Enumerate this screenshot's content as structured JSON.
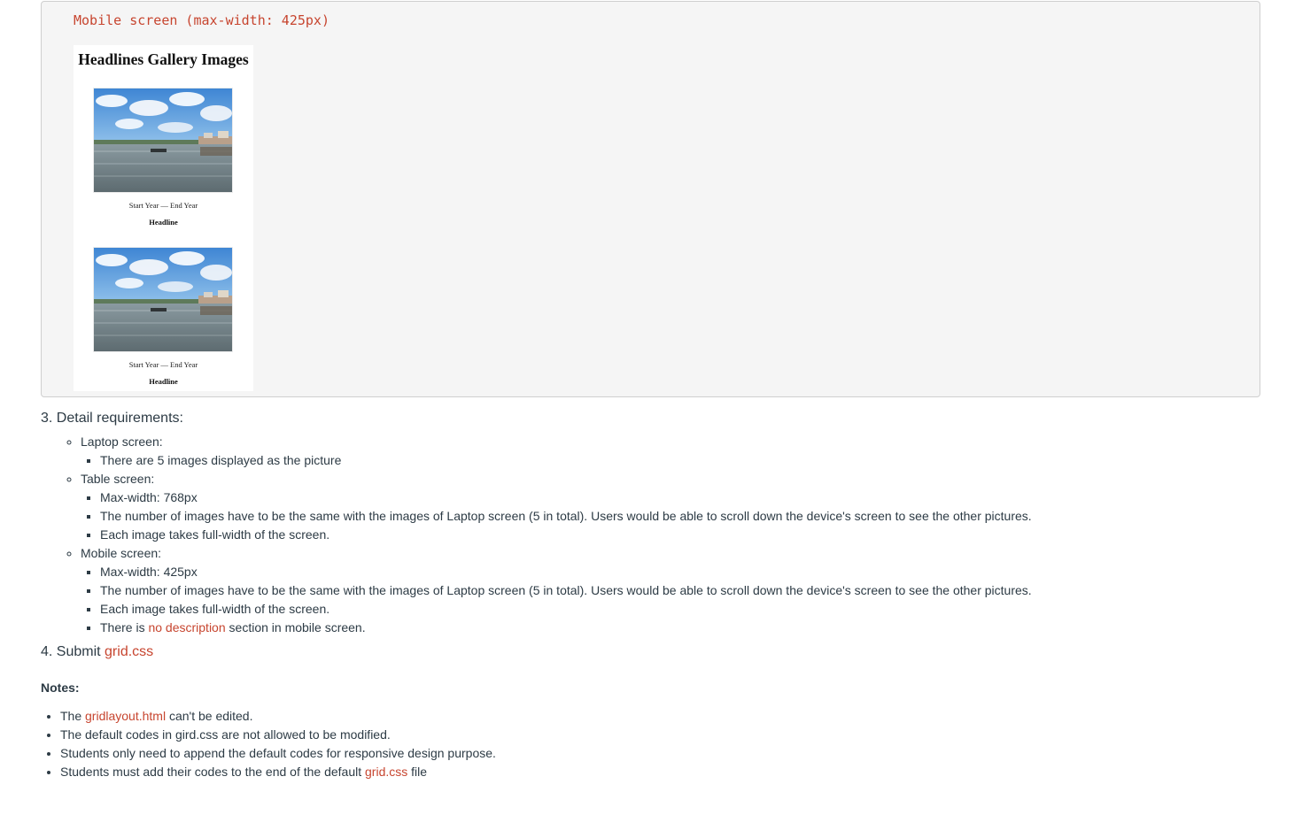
{
  "example": {
    "caption": "Mobile screen (max-width: 425px)",
    "preview": {
      "title": "Headlines Gallery Images",
      "items": [
        {
          "years": "Start Year — End Year",
          "headline": "Headline"
        },
        {
          "years": "Start Year — End Year",
          "headline": "Headline"
        }
      ]
    }
  },
  "requirements": {
    "heading": "3. Detail requirements:",
    "laptop": {
      "label": "Laptop screen:",
      "items": [
        "There are 5 images displayed as the picture"
      ]
    },
    "table": {
      "label": "Table screen:",
      "items": [
        "Max-width: 768px",
        "The number of images have to be the same with the images of Laptop screen (5 in total). Users would be able to scroll down the device's screen to see the other pictures.",
        "Each image takes full-width of the screen."
      ]
    },
    "mobile": {
      "label": "Mobile screen:",
      "items": [
        "Max-width: 425px",
        "The number of images have to be the same with the images of Laptop screen (5 in total). Users would be able to scroll down the device's screen to see the other pictures.",
        "Each image takes full-width of the screen."
      ],
      "last": {
        "before": "There is ",
        "highlight": "no description",
        "after": " section in mobile screen."
      }
    }
  },
  "submit": {
    "prefix": "4. Submit ",
    "file": "grid.css"
  },
  "notes": {
    "title": "Notes:",
    "items": [
      {
        "before": "The ",
        "highlight": "gridlayout.html",
        "after": " can't be edited."
      },
      {
        "text": "The default codes in gird.css are not allowed to be modified."
      },
      {
        "text": "Students only need to append the default codes for responsive design purpose."
      },
      {
        "before": "Students must add their codes to the end of the default ",
        "highlight": "grid.css",
        "after": " file"
      }
    ]
  },
  "colors": {
    "accent": "#c7452f",
    "text": "#2d3b45",
    "code_bg": "#f5f5f5"
  }
}
